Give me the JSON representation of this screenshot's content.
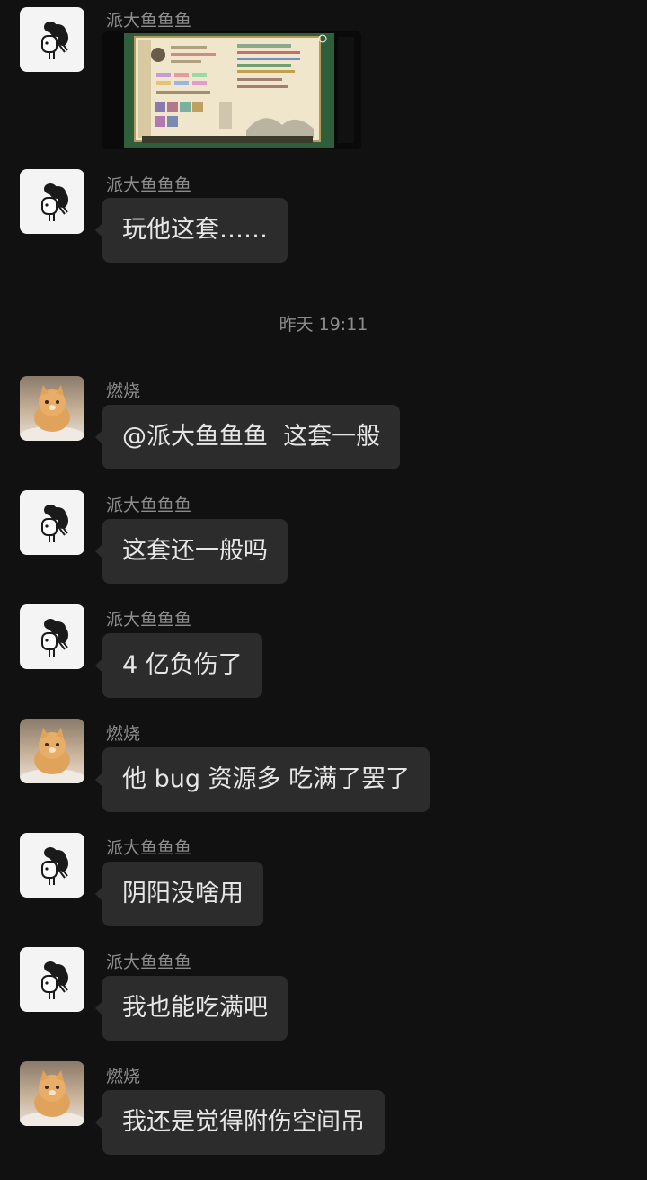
{
  "messages": [
    {
      "sender": "派大鱼鱼鱼",
      "type": "image",
      "avatar": "fish-avatar"
    },
    {
      "sender": "派大鱼鱼鱼",
      "text": "玩他这套……",
      "avatar": "fish-avatar"
    },
    {
      "sender": "燃烧",
      "text": "@派大鱼鱼鱼  这套一般",
      "avatar": "cat-avatar"
    },
    {
      "sender": "派大鱼鱼鱼",
      "text": "这套还一般吗",
      "avatar": "fish-avatar"
    },
    {
      "sender": "派大鱼鱼鱼",
      "text": "4 亿负伤了",
      "avatar": "fish-avatar"
    },
    {
      "sender": "燃烧",
      "text": "他 bug 资源多 吃满了罢了",
      "avatar": "cat-avatar"
    },
    {
      "sender": "派大鱼鱼鱼",
      "text": "阴阳没啥用",
      "avatar": "fish-avatar"
    },
    {
      "sender": "派大鱼鱼鱼",
      "text": "我也能吃满吧",
      "avatar": "fish-avatar"
    },
    {
      "sender": "燃烧",
      "text": "我还是觉得附伤空间吊",
      "avatar": "cat-avatar"
    }
  ],
  "timestamp": "昨天 19:11",
  "colors": {
    "background": "#111111",
    "bubble": "#2c2c2c",
    "text": "#e6e6e6",
    "meta": "#8c8c8c"
  }
}
